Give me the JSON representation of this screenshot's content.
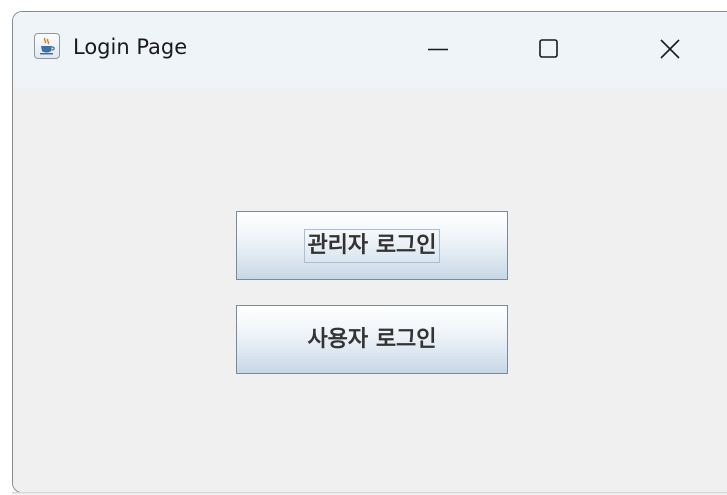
{
  "window": {
    "title": "Login Page",
    "icon": "java-cup-icon",
    "controls": {
      "minimize_icon": "minimize-icon",
      "maximize_icon": "maximize-icon",
      "close_icon": "close-icon"
    }
  },
  "buttons": {
    "admin_login": "관리자 로그인",
    "user_login": "사용자 로그인"
  },
  "colors": {
    "titlebar": "#eff4f9",
    "client_background": "#f0f0f0",
    "button_border": "#7a8a99",
    "focus_border": "#a9bfd6",
    "button_text": "#333333"
  }
}
